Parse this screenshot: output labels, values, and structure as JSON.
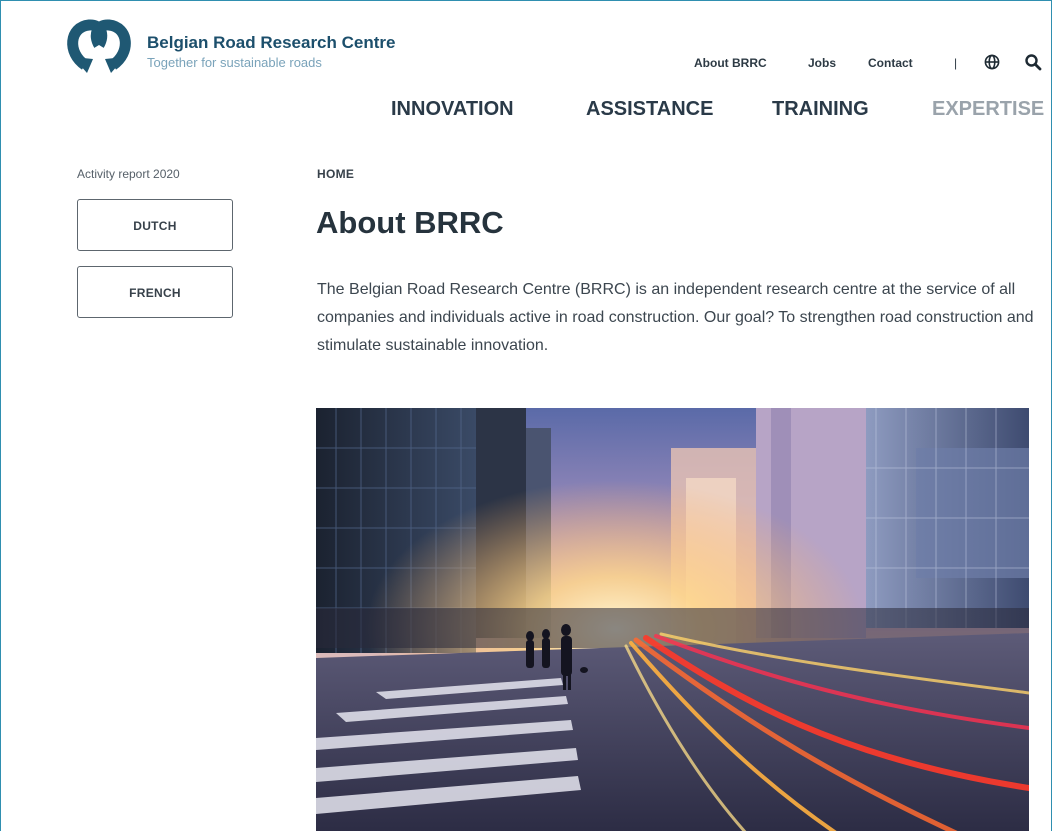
{
  "header": {
    "brand_name": "Belgian Road Research Centre",
    "tagline": "Together for sustainable roads",
    "top_links": [
      "About BRRC",
      "Jobs",
      "Contact"
    ],
    "separator": "|",
    "icons": [
      "globe-icon",
      "search-icon"
    ]
  },
  "nav": {
    "items": [
      "INNOVATION",
      "ASSISTANCE",
      "TRAINING",
      "EXPERTISE"
    ]
  },
  "sidebar": {
    "activity_report": "Activity report 2020",
    "buttons": [
      "DUTCH",
      "FRENCH"
    ]
  },
  "main": {
    "breadcrumb": "HOME",
    "title": "About BRRC",
    "intro": "The Belgian Road Research Centre (BRRC) is an independent research centre at the service of all companies and individuals active in road construction. Our goal? To strengthen road construction and stimulate sustainable innovation."
  },
  "colors": {
    "brand": "#1c4f6c",
    "tagline": "#7aa3ba",
    "text": "#26333d",
    "frame_border": "#2f8fb0",
    "muted_nav": "#9aa3ab"
  }
}
